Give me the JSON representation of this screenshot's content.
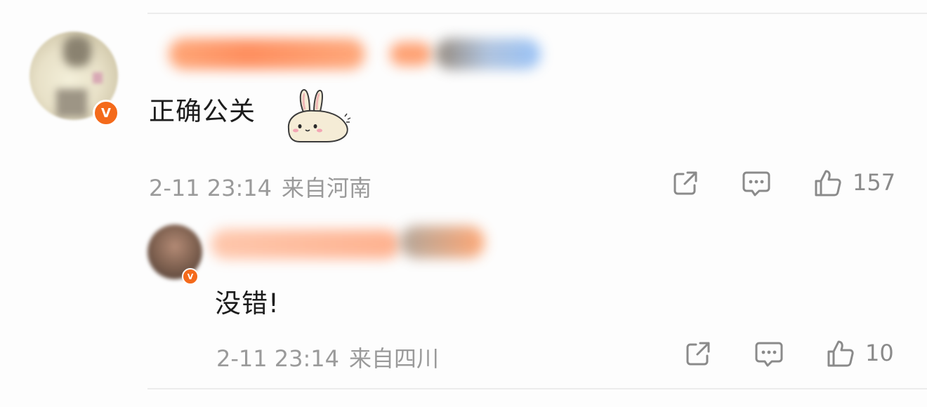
{
  "comments": [
    {
      "text": "正确公关",
      "time": "2-11 23:14",
      "location": "来自河南",
      "likes": "157",
      "verified_mark": "V"
    },
    {
      "text": "没错!",
      "time": "2-11 23:14",
      "location": "来自四川",
      "likes": "10",
      "verified_mark": "V"
    }
  ],
  "icons": {
    "share": "share-icon",
    "reply": "comment-icon",
    "like": "thumbs-up-icon",
    "sticker": "bunny-sticker"
  },
  "colors": {
    "verified_badge": "#f46a1b",
    "meta_text": "#9a9a9a",
    "icon_stroke": "#8a8a8a"
  }
}
